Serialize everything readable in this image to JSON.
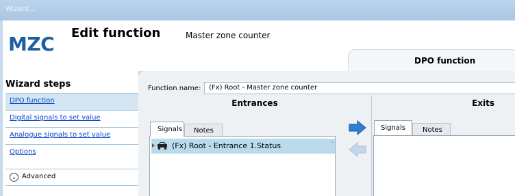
{
  "window": {
    "title": "Wizard..."
  },
  "header": {
    "logo": "MZC",
    "title": "Edit function",
    "subtitle": "Master zone counter",
    "tab_label": "DPO function"
  },
  "sidebar": {
    "title": "Wizard steps",
    "steps": [
      {
        "label": "DPO function",
        "active": true
      },
      {
        "label": "Digital signals to set value",
        "active": false
      },
      {
        "label": "Analogue signals to set value",
        "active": false
      },
      {
        "label": "Options",
        "active": false
      }
    ],
    "advanced_label": "Advanced"
  },
  "main": {
    "function_name_label": "Function name:",
    "function_name_value": "(Fx) Root - Master zone counter",
    "entrances": {
      "title": "Entrances",
      "tabs": [
        "Signals",
        "Notes"
      ],
      "items": [
        "(Fx) Root - Entrance 1.Status"
      ]
    },
    "exits": {
      "title": "Exits",
      "tabs": [
        "Signals",
        "Notes"
      ]
    }
  },
  "colors": {
    "accent_blue": "#1d5fa0",
    "selected_row": "#b9dbeb",
    "active_step": "#d4e5f3",
    "link": "#0645c8",
    "arrow_blue": "#2f7fd3"
  },
  "icons": [
    "car-icon",
    "arrow-right-icon",
    "arrow-left-icon",
    "chevron-down-icon",
    "expand-caret-icon"
  ]
}
